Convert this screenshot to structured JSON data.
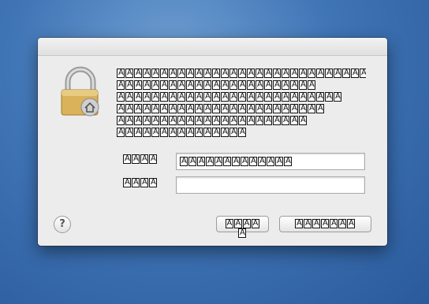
{
  "dialog": {
    "message_lines": [
      {
        "glyph_count": 29
      },
      {
        "glyph_count": 23
      },
      {
        "glyph_count": 26
      },
      {
        "glyph_count": 24
      },
      {
        "glyph_count": 22
      },
      {
        "glyph_count": 15
      }
    ],
    "name_label_glyphs": 4,
    "name_value_glyphs": 13,
    "password_label_glyphs": 4,
    "password_value": "",
    "help_label": "?",
    "cancel_glyphs": 5,
    "ok_glyphs": 7
  },
  "icons": {
    "lock": "lock-icon",
    "help": "help-icon"
  },
  "colors": {
    "desktop": "#3f74b5",
    "dialog_bg": "#ececec",
    "lock_gold": "#d9b25a"
  }
}
